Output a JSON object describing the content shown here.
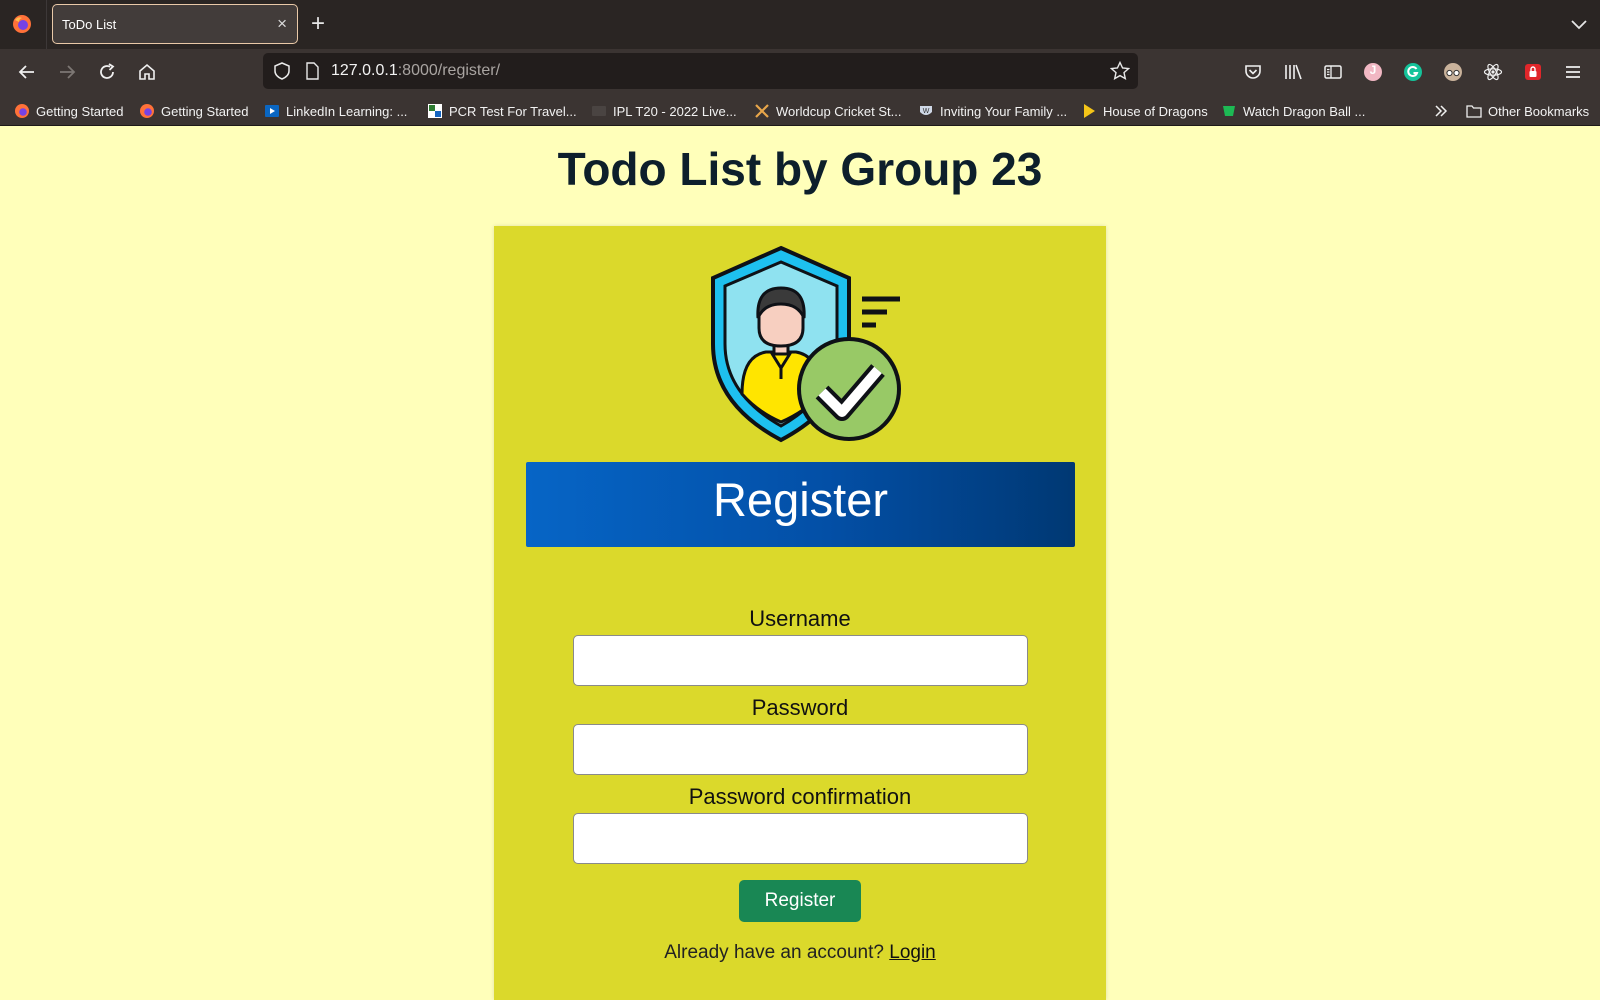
{
  "browser": {
    "tab_title": "ToDo List",
    "tab_close": "×",
    "new_tab": "+",
    "url_host": "127.0.0.1",
    "url_rest": ":8000/register/",
    "extension_avatar_letter": "J",
    "bookmarks": [
      {
        "label": "Getting Started",
        "icon": "firefox-icon"
      },
      {
        "label": "Getting Started",
        "icon": "firefox-icon"
      },
      {
        "label": "LinkedIn Learning: ...",
        "icon": "linkedin-learning-icon"
      },
      {
        "label": "PCR Test For Travel...",
        "icon": "pcr-icon"
      },
      {
        "label": "IPL T20 - 2022 Live...",
        "icon": "tv-icon"
      },
      {
        "label": "Worldcup Cricket St...",
        "icon": "cricket-icon"
      },
      {
        "label": "Inviting Your Family ...",
        "icon": "wp-icon"
      },
      {
        "label": "House of Dragons",
        "icon": "play-icon"
      },
      {
        "label": "Watch Dragon Ball ...",
        "icon": "tv-green-icon"
      }
    ],
    "other_bookmarks": "Other Bookmarks"
  },
  "page": {
    "title": "Todo List by Group 23",
    "banner": "Register",
    "fields": {
      "username_label": "Username",
      "password_label": "Password",
      "password_confirm_label": "Password confirmation",
      "username_value": "",
      "password_value": "",
      "password_confirm_value": ""
    },
    "register_button": "Register",
    "login_prompt": "Already have an account?",
    "login_link": "Login"
  },
  "colors": {
    "page_bg": "#ffffba",
    "card_bg": "#dbd92b",
    "banner_start": "#0665c6",
    "banner_end": "#003873",
    "button": "#198754"
  }
}
